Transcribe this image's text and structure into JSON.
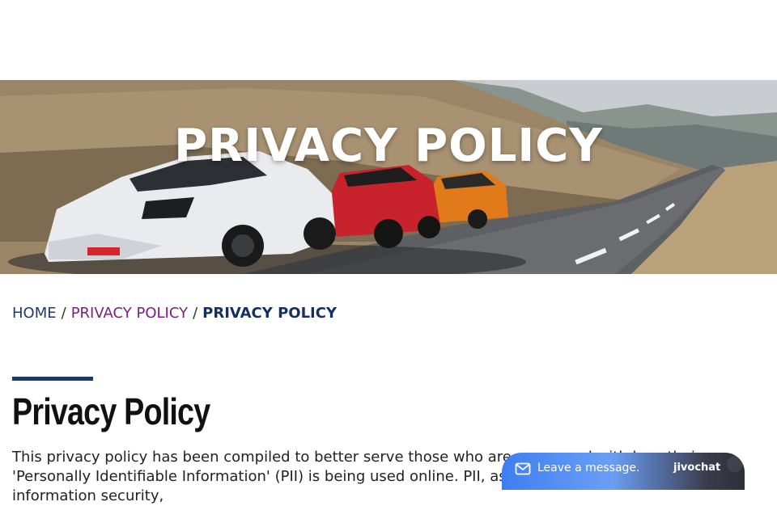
{
  "hero": {
    "title": "PRIVACY POLICY"
  },
  "breadcrumb": {
    "home": "HOME",
    "separator": "/",
    "parent": "PRIVACY POLICY",
    "current": "PRIVACY POLICY"
  },
  "content": {
    "heading": "Privacy Policy",
    "paragraph": "This privacy policy has been compiled to better serve those who are concerned with how their 'Personally Identifiable Information' (PII) is being used online. PII, as described in US privacy law and information security,"
  },
  "chat": {
    "label": "Leave a message.",
    "brand": "jivochat",
    "icon": "mail-icon"
  },
  "colors": {
    "breadcrumb_home": "#1f3a6b",
    "breadcrumb_link": "#7a1f7a",
    "breadcrumb_current": "#15305e",
    "accent_rule": "#1b3a62",
    "chat_blue": "#3d7ef0",
    "chat_dark": "#2e2e3a"
  }
}
